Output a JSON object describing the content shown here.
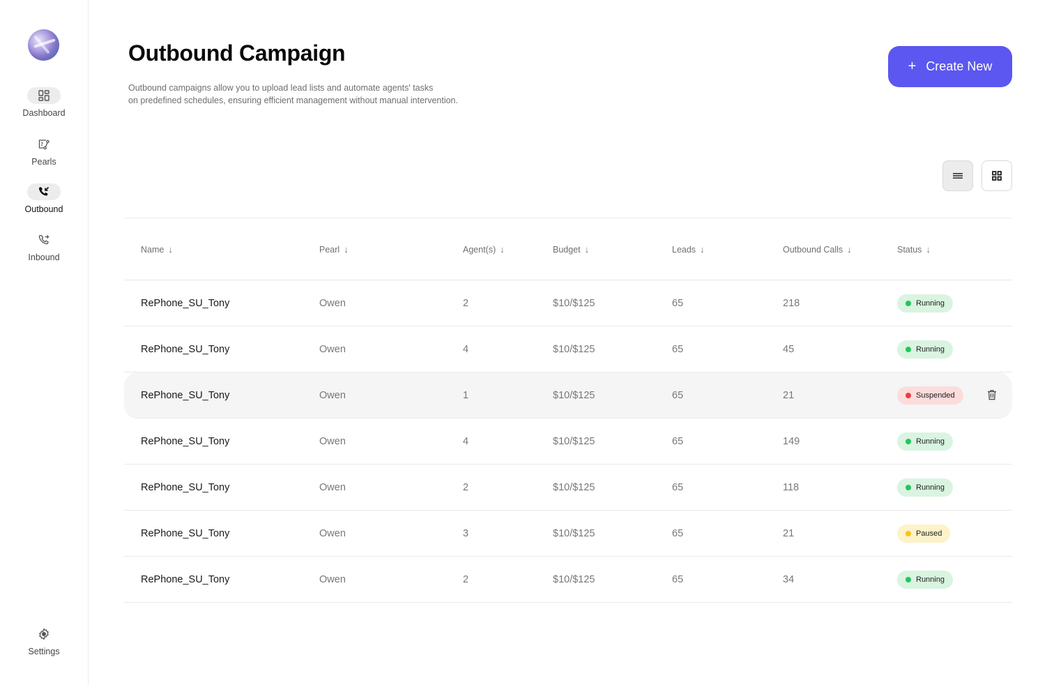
{
  "sidebar": {
    "logo": "app-logo-sphere",
    "items": [
      {
        "label": "Dashboard",
        "icon": "dashboard-grid-icon",
        "active_bg": true
      },
      {
        "label": "Pearls",
        "icon": "pearls-flow-icon",
        "active_bg": false
      },
      {
        "label": "Outbound",
        "icon": "phone-outgoing-icon",
        "active_bg": true,
        "current": true
      },
      {
        "label": "Inbound",
        "icon": "phone-incoming-icon",
        "active_bg": false
      }
    ],
    "settings": {
      "label": "Settings",
      "icon": "gear-icon"
    }
  },
  "header": {
    "title": "Outbound Campaign",
    "description_line1": "Outbound campaigns allow you to upload lead lists and automate agents' tasks",
    "description_line2": "on predefined schedules, ensuring efficient management without manual intervention.",
    "create_button": {
      "icon": "+",
      "label": "Create New"
    }
  },
  "colors": {
    "accent": "#5b57f0",
    "running_bg": "#d9f4e0",
    "running_dot": "#22c55e",
    "suspended_bg": "#fddcdc",
    "suspended_dot": "#ef3b3b",
    "paused_bg": "#fdf2c8",
    "paused_dot": "#f5c518"
  },
  "view_toggle": {
    "list": "list-view-icon",
    "grid": "grid-view-icon",
    "selected": "list"
  },
  "table": {
    "columns": [
      "Name",
      "Pearl",
      "Agent(s)",
      "Budget",
      "Leads",
      "Outbound Calls",
      "Status"
    ],
    "sort_icon": "↓",
    "rows": [
      {
        "name": "RePhone_SU_Tony",
        "pearl": "Owen",
        "agents": "2",
        "budget": "$10/$125",
        "leads": "65",
        "calls": "218",
        "status": "Running"
      },
      {
        "name": "RePhone_SU_Tony",
        "pearl": "Owen",
        "agents": "4",
        "budget": "$10/$125",
        "leads": "65",
        "calls": "45",
        "status": "Running"
      },
      {
        "name": "RePhone_SU_Tony",
        "pearl": "Owen",
        "agents": "1",
        "budget": "$10/$125",
        "leads": "65",
        "calls": "21",
        "status": "Suspended",
        "hovered": true
      },
      {
        "name": "RePhone_SU_Tony",
        "pearl": "Owen",
        "agents": "4",
        "budget": "$10/$125",
        "leads": "65",
        "calls": "149",
        "status": "Running"
      },
      {
        "name": "RePhone_SU_Tony",
        "pearl": "Owen",
        "agents": "2",
        "budget": "$10/$125",
        "leads": "65",
        "calls": "118",
        "status": "Running"
      },
      {
        "name": "RePhone_SU_Tony",
        "pearl": "Owen",
        "agents": "3",
        "budget": "$10/$125",
        "leads": "65",
        "calls": "21",
        "status": "Paused"
      },
      {
        "name": "RePhone_SU_Tony",
        "pearl": "Owen",
        "agents": "2",
        "budget": "$10/$125",
        "leads": "65",
        "calls": "34",
        "status": "Running"
      }
    ]
  }
}
